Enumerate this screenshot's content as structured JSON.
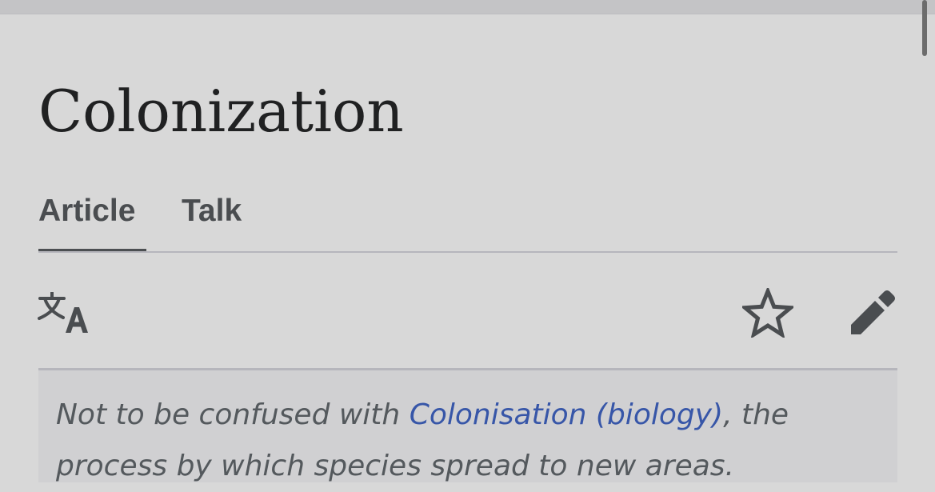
{
  "page": {
    "title": "Colonization"
  },
  "tabs": [
    {
      "label": "Article",
      "selected": true
    },
    {
      "label": "Talk",
      "selected": false
    }
  ],
  "actions": {
    "translate_icon": "translate-icon",
    "watch_icon": "star-icon",
    "edit_icon": "pencil-icon"
  },
  "hatnote": {
    "prefix": "Not to be confused with ",
    "link_text": "Colonisation (biology)",
    "suffix": ", the process by which species spread to new areas."
  },
  "colors": {
    "background": "#d8d8d8",
    "text": "#202122",
    "tab_text": "#4a4d50",
    "link": "#3756a8",
    "hatnote_text": "#54595d",
    "hatnote_background": "#d0d0d2"
  }
}
